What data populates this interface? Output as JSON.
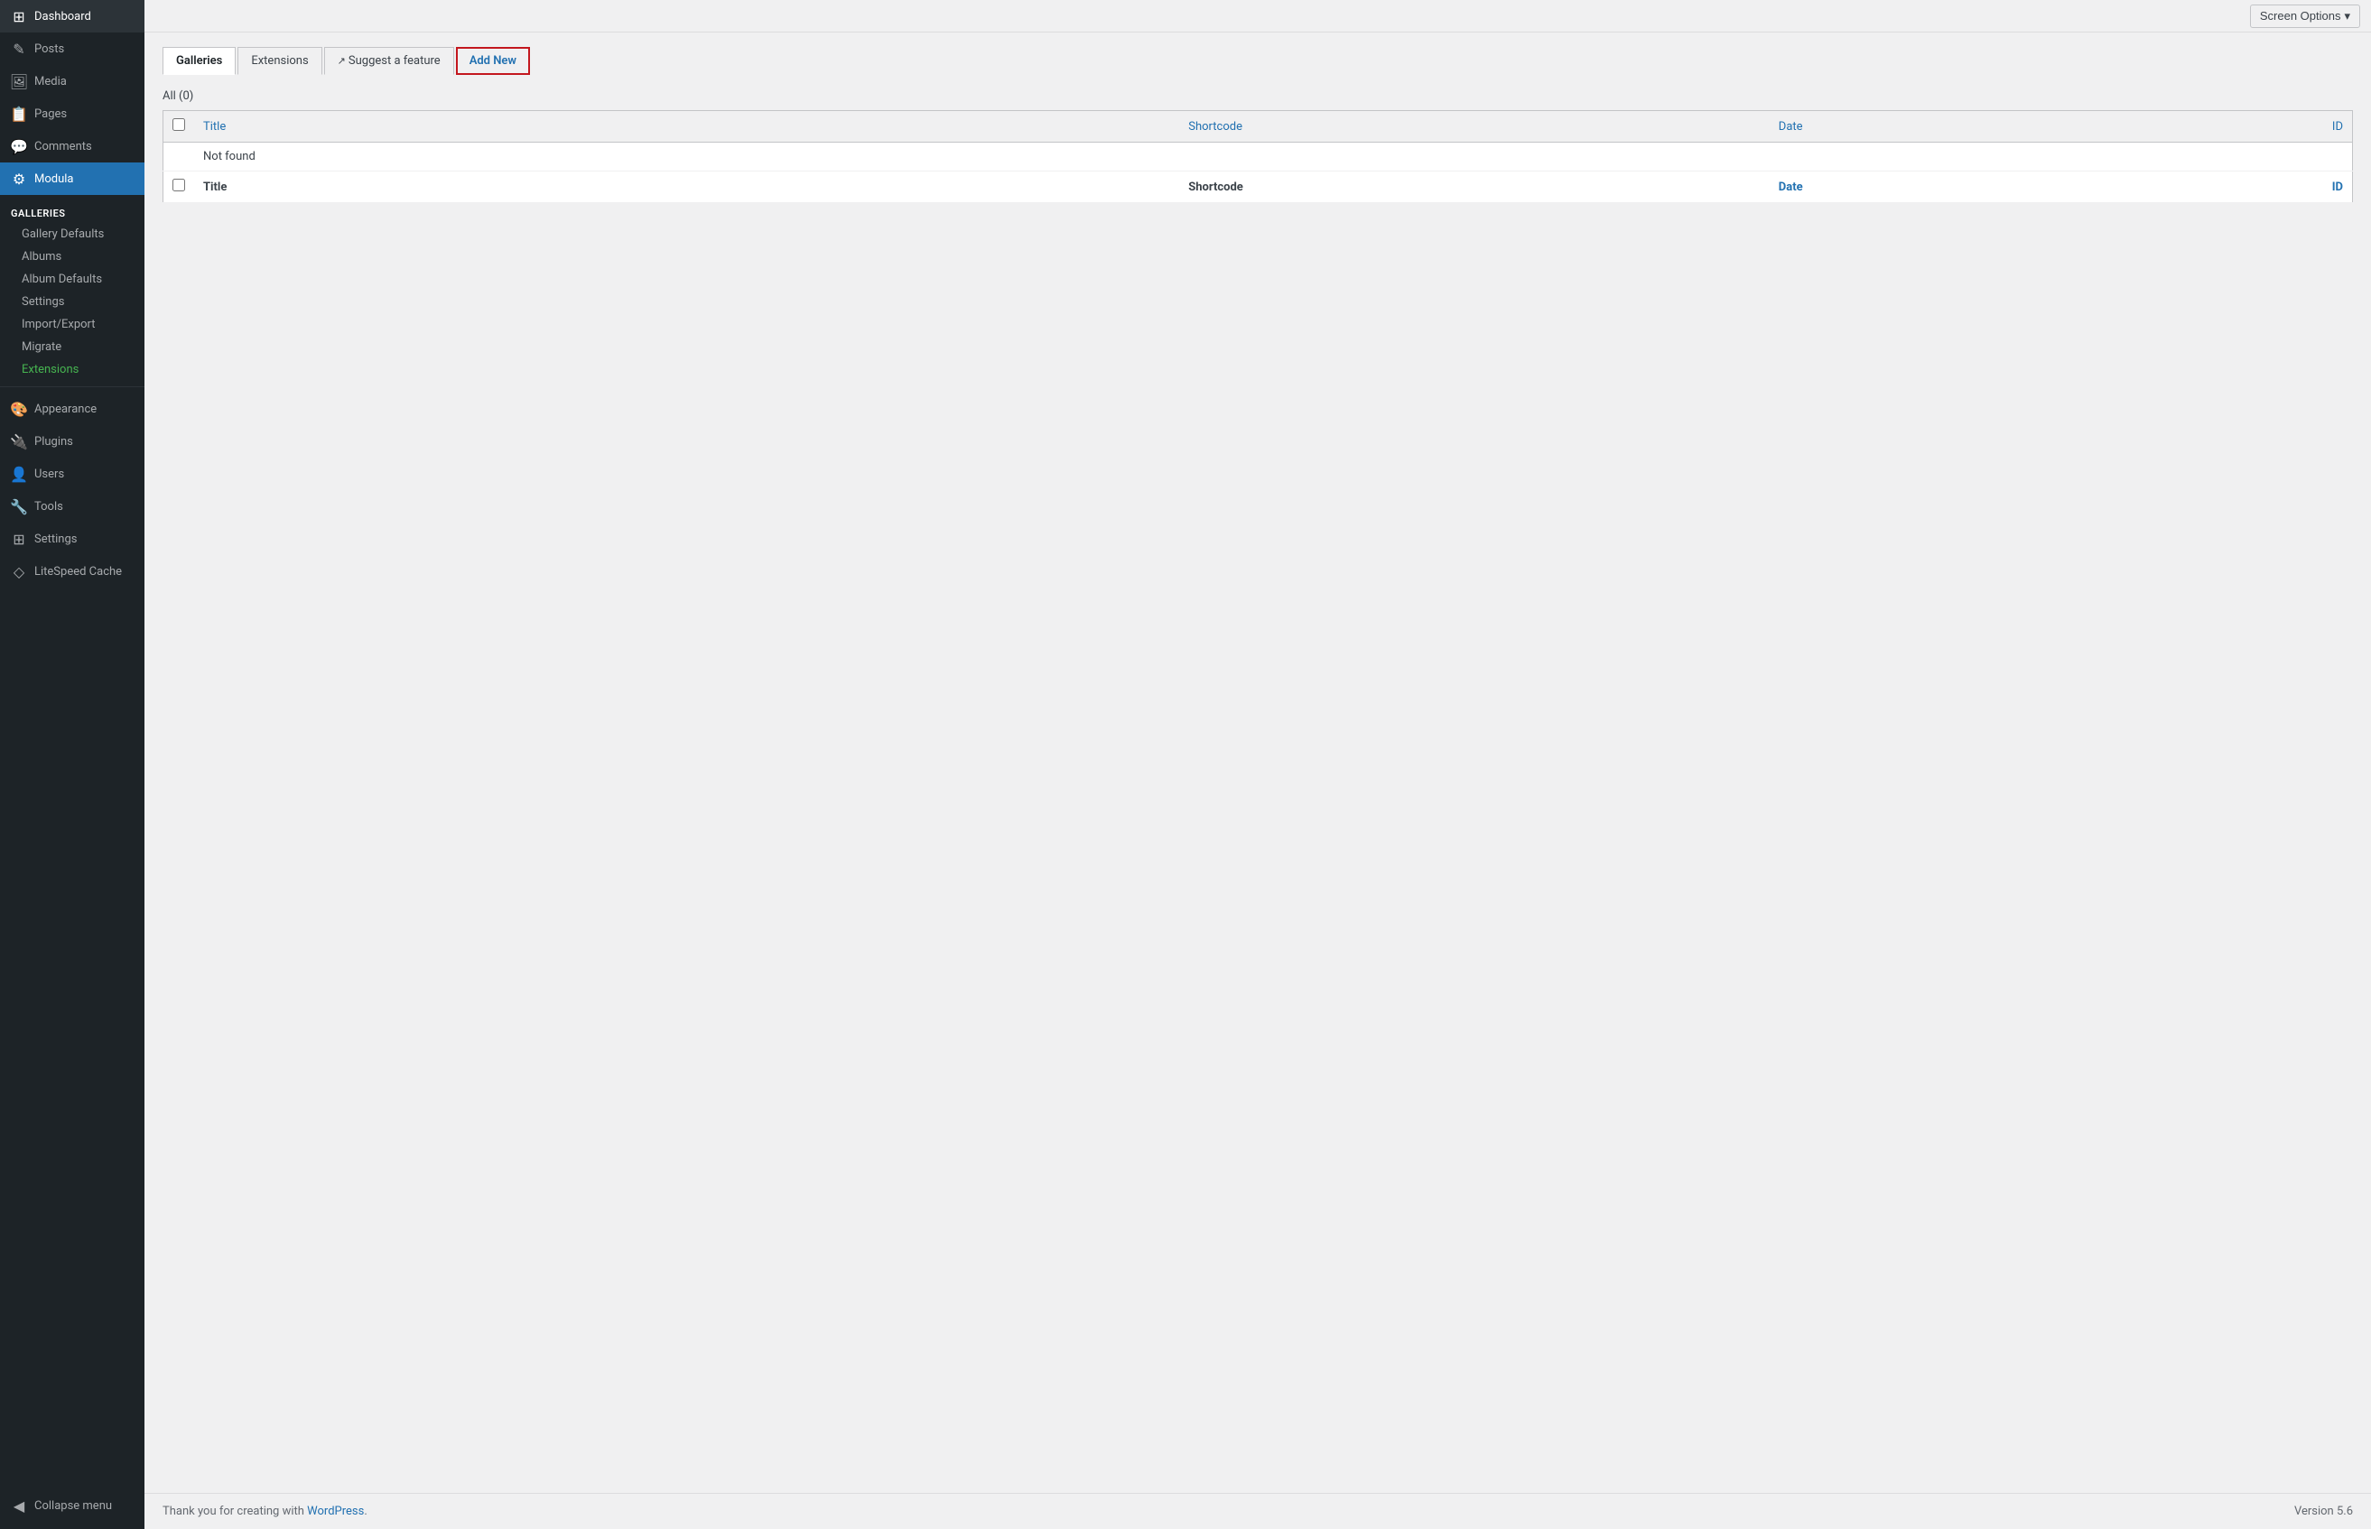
{
  "sidebar": {
    "items": [
      {
        "id": "dashboard",
        "label": "Dashboard",
        "icon": "⊞"
      },
      {
        "id": "posts",
        "label": "Posts",
        "icon": "📄"
      },
      {
        "id": "media",
        "label": "Media",
        "icon": "🖼"
      },
      {
        "id": "pages",
        "label": "Pages",
        "icon": "📋"
      },
      {
        "id": "comments",
        "label": "Comments",
        "icon": "💬"
      },
      {
        "id": "modula",
        "label": "Modula",
        "icon": "⚙",
        "active": true
      }
    ],
    "modula_sub": [
      {
        "id": "galleries",
        "label": "Galleries",
        "active": false,
        "is_header": true
      },
      {
        "id": "gallery-defaults",
        "label": "Gallery Defaults"
      },
      {
        "id": "albums",
        "label": "Albums"
      },
      {
        "id": "album-defaults",
        "label": "Album Defaults"
      },
      {
        "id": "settings",
        "label": "Settings"
      },
      {
        "id": "import-export",
        "label": "Import/Export"
      },
      {
        "id": "migrate",
        "label": "Migrate"
      },
      {
        "id": "extensions",
        "label": "Extensions",
        "highlight": true
      }
    ],
    "bottom_items": [
      {
        "id": "appearance",
        "label": "Appearance",
        "icon": "🎨"
      },
      {
        "id": "plugins",
        "label": "Plugins",
        "icon": "🔌"
      },
      {
        "id": "users",
        "label": "Users",
        "icon": "👤"
      },
      {
        "id": "tools",
        "label": "Tools",
        "icon": "🔧"
      },
      {
        "id": "settings",
        "label": "Settings",
        "icon": "⊞"
      },
      {
        "id": "litespeed",
        "label": "LiteSpeed Cache",
        "icon": "◇"
      }
    ],
    "collapse_label": "Collapse menu"
  },
  "topbar": {
    "screen_options_label": "Screen Options",
    "screen_options_arrow": "▾"
  },
  "tabs": [
    {
      "id": "galleries",
      "label": "Galleries",
      "active": true
    },
    {
      "id": "extensions",
      "label": "Extensions",
      "active": false
    },
    {
      "id": "suggest",
      "label": "Suggest a feature",
      "active": false,
      "external": true
    },
    {
      "id": "add-new",
      "label": "Add New",
      "active": false,
      "highlighted": true
    }
  ],
  "filter": {
    "all_label": "All",
    "all_count": "(0)"
  },
  "table": {
    "headers": [
      {
        "id": "checkbox",
        "label": ""
      },
      {
        "id": "title",
        "label": "Title"
      },
      {
        "id": "shortcode",
        "label": "Shortcode"
      },
      {
        "id": "date",
        "label": "Date"
      },
      {
        "id": "id",
        "label": "ID"
      }
    ],
    "rows": [],
    "not_found_message": "Not found",
    "footer_headers": [
      {
        "id": "checkbox",
        "label": ""
      },
      {
        "id": "title",
        "label": "Title"
      },
      {
        "id": "shortcode",
        "label": "Shortcode"
      },
      {
        "id": "date",
        "label": "Date"
      },
      {
        "id": "id",
        "label": "ID"
      }
    ]
  },
  "footer": {
    "thank_you_text": "Thank you for creating with",
    "wp_link_label": "WordPress",
    "version_label": "Version 5.6"
  }
}
